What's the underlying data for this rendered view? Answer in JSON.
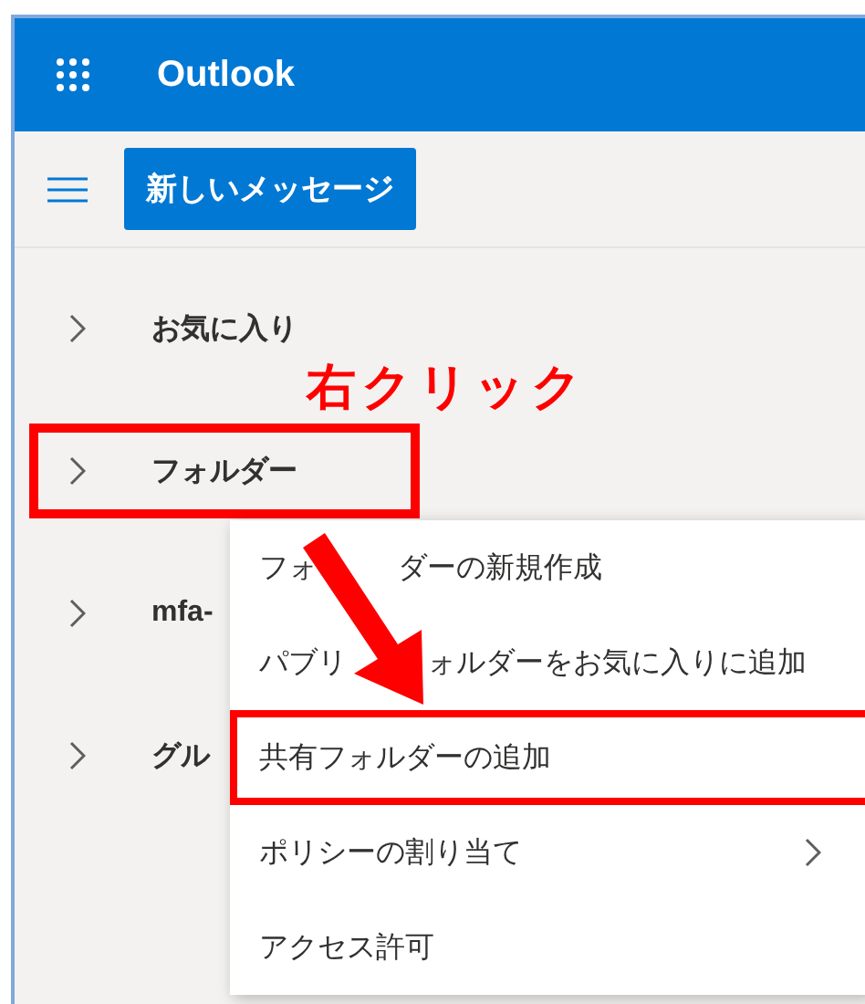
{
  "header": {
    "title": "Outlook"
  },
  "toolbar": {
    "new_message_button": "新しいメッセージ"
  },
  "nav_items": [
    {
      "label": "お気に入り",
      "expanded": false,
      "highlighted": false
    },
    {
      "label": "フォルダー",
      "expanded": false,
      "highlighted": true
    },
    {
      "label": "mfa-",
      "expanded": false,
      "highlighted": false
    },
    {
      "label": "グル",
      "expanded": false,
      "highlighted": false
    }
  ],
  "context_menu": [
    {
      "label": [
        "フォ",
        "ダーの新規作成"
      ],
      "has_submenu": false,
      "highlighted": false
    },
    {
      "label": [
        "パブリ",
        "ォルダーをお気に入りに追加"
      ],
      "has_submenu": false,
      "highlighted": false
    },
    {
      "label": [
        "共有フォルダーの追加"
      ],
      "has_submenu": false,
      "highlighted": true
    },
    {
      "label": [
        "ポリシーの割り当て"
      ],
      "has_submenu": true,
      "highlighted": false
    },
    {
      "label": [
        "アクセス許可"
      ],
      "has_submenu": false,
      "highlighted": false
    }
  ],
  "annotation": {
    "label": "右クリック"
  }
}
